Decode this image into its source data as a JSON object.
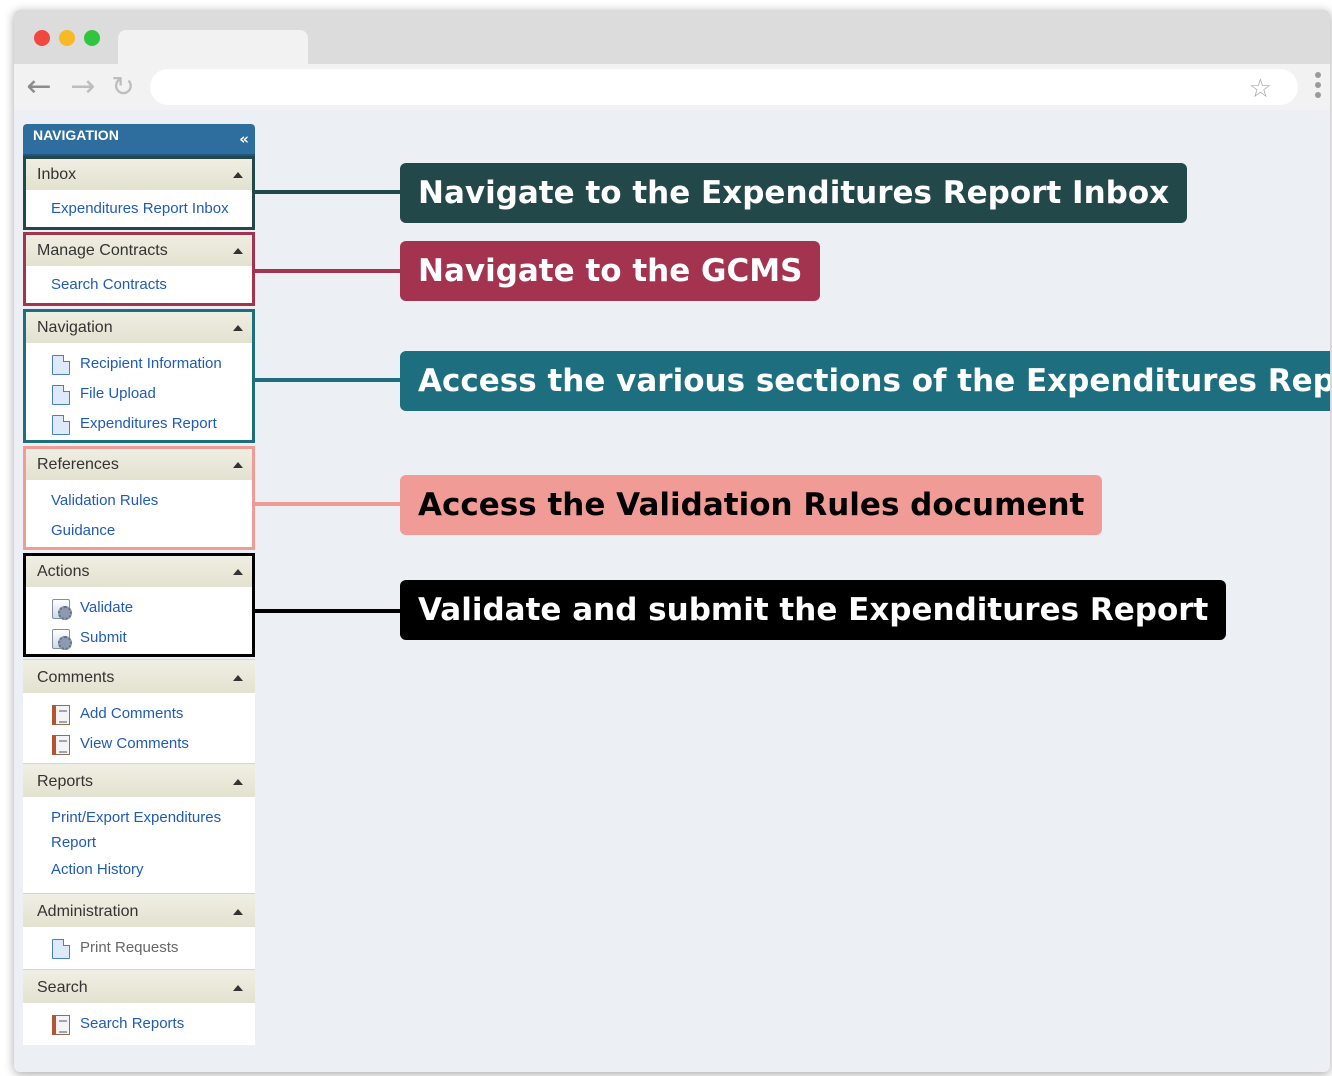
{
  "browser": {
    "traffic_lights": [
      "close",
      "minimize",
      "maximize"
    ],
    "address_value": "",
    "icons": [
      "back-arrow",
      "forward-arrow",
      "reload",
      "bookmark-star",
      "menu-dots"
    ]
  },
  "sidebar": {
    "title": "NAVIGATION",
    "collapse_glyph": "«",
    "sections": {
      "inbox": {
        "title": "Inbox",
        "items": [
          "Expenditures Report Inbox"
        ]
      },
      "manage": {
        "title": "Manage Contracts",
        "items": [
          "Search Contracts"
        ]
      },
      "navigation": {
        "title": "Navigation",
        "items": [
          "Recipient Information",
          "File Upload",
          "Expenditures Report"
        ]
      },
      "references": {
        "title": "References",
        "items": [
          "Validation Rules",
          "Guidance"
        ]
      },
      "actions": {
        "title": "Actions",
        "items": [
          "Validate",
          "Submit"
        ]
      },
      "comments": {
        "title": "Comments",
        "items": [
          "Add Comments",
          "View Comments"
        ]
      },
      "reports": {
        "title": "Reports",
        "items": [
          "Print/Export Expenditures Report",
          "Action History"
        ]
      },
      "administration": {
        "title": "Administration",
        "items": [
          "Print Requests"
        ]
      },
      "search": {
        "title": "Search",
        "items": [
          "Search Reports"
        ]
      }
    }
  },
  "callouts": [
    {
      "text": "Navigate to the Expenditures Report Inbox",
      "color": "#23484a"
    },
    {
      "text": "Navigate to the GCMS",
      "color": "#a3334e"
    },
    {
      "text": "Access the various sections of the Expenditures Report",
      "color": "#1d6f80"
    },
    {
      "text": "Access the Validation Rules document",
      "color": "#f09b95"
    },
    {
      "text": "Validate and submit the Expenditures Report",
      "color": "#000000"
    }
  ]
}
